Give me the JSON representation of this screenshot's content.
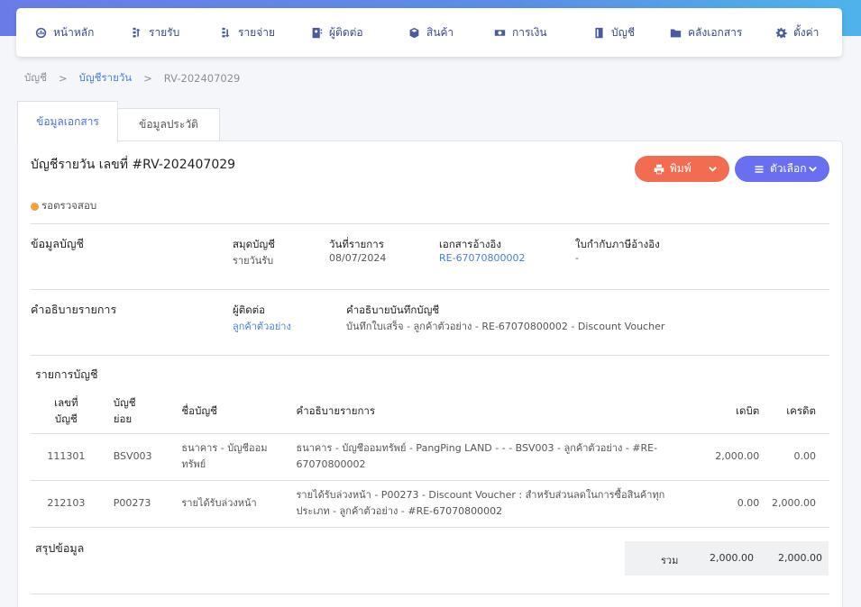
{
  "nav": [
    {
      "label": "หน้าหลัก",
      "icon": "dashboard-icon"
    },
    {
      "label": "รายรับ",
      "icon": "income-icon"
    },
    {
      "label": "รายจ่าย",
      "icon": "expense-icon"
    },
    {
      "label": "ผู้ติดต่อ",
      "icon": "contacts-icon"
    },
    {
      "label": "สินค้า",
      "icon": "product-box-icon"
    },
    {
      "label": "การเงิน",
      "icon": "money-icon"
    },
    {
      "label": "บัญชี",
      "icon": "ledger-icon"
    },
    {
      "label": "คลังเอกสาร",
      "icon": "folder-icon"
    },
    {
      "label": "ตั้งค่า",
      "icon": "gear-icon"
    }
  ],
  "breadcrumb": {
    "root": "บัญชี",
    "section": "บัญชีรายวัน",
    "current": "RV-202407029",
    "separator": ">"
  },
  "tabs": {
    "document": "ข้อมูลเอกสาร",
    "history": "ข้อมูลประวัติ"
  },
  "document": {
    "title": "บัญชีรายวัน เลขที่ #RV-202407029",
    "status": "รอตรวจสอบ",
    "status_color": "#f5a03a"
  },
  "buttons": {
    "print": "พิมพ์",
    "options": "ตัวเลือก",
    "print_color": "#f26c52",
    "options_color": "#6a6ef0"
  },
  "account_info": {
    "section_label": "ข้อมูลบัญชี",
    "journal_book_label": "สมุดบัญชี",
    "journal_book_value": "รายวันรับ",
    "transaction_date_label": "วันที่รายการ",
    "transaction_date_value": "08/07/2024",
    "reference_doc_label": "เอกสารอ้างอิง",
    "reference_doc_value": "RE-67070800002",
    "tax_invoice_label": "ใบกำกับภาษีอ้างอิง",
    "tax_invoice_value": "-"
  },
  "description_info": {
    "section_label": "คำอธิบายรายการ",
    "contact_label": "ผู้ติดต่อ",
    "contact_value": "ลูกค้าตัวอย่าง",
    "memo_label": "คำอธิบายบันทึกบัญชี",
    "memo_value": "บันทึกใบเสร็จ - ลูกค้าตัวอย่าง - RE-67070800002 - Discount Voucher"
  },
  "entries": {
    "section_label": "รายการบัญชี",
    "headers": {
      "code": "เลขที่บัญชี",
      "subaccount": "บัญชีย่อย",
      "name": "ชื่อบัญชี",
      "description": "คำอธิบายรายการ",
      "debit": "เดบิต",
      "credit": "เครดิต"
    },
    "rows": [
      {
        "code": "111301",
        "subaccount": "BSV003",
        "name": "ธนาคาร - บัญชีออมทรัพย์",
        "description": "ธนาคาร - บัญชีออมทรัพย์ - PangPing LAND - - - BSV003 - ลูกค้าตัวอย่าง - #RE-67070800002",
        "debit": "2,000.00",
        "credit": "0.00"
      },
      {
        "code": "212103",
        "subaccount": "P00273",
        "name": "รายได้รับล่วงหน้า",
        "description": "รายได้รับล่วงหน้า - P00273 - Discount Voucher : สำหรับส่วนลดในการซื้อสินค้าทุกประเภท - ลูกค้าตัวอย่าง - #RE-67070800002",
        "debit": "0.00",
        "credit": "2,000.00"
      }
    ]
  },
  "summary": {
    "section_label": "สรุปข้อมูล",
    "total_label": "รวม",
    "total_debit": "2,000.00",
    "total_credit": "2,000.00"
  }
}
